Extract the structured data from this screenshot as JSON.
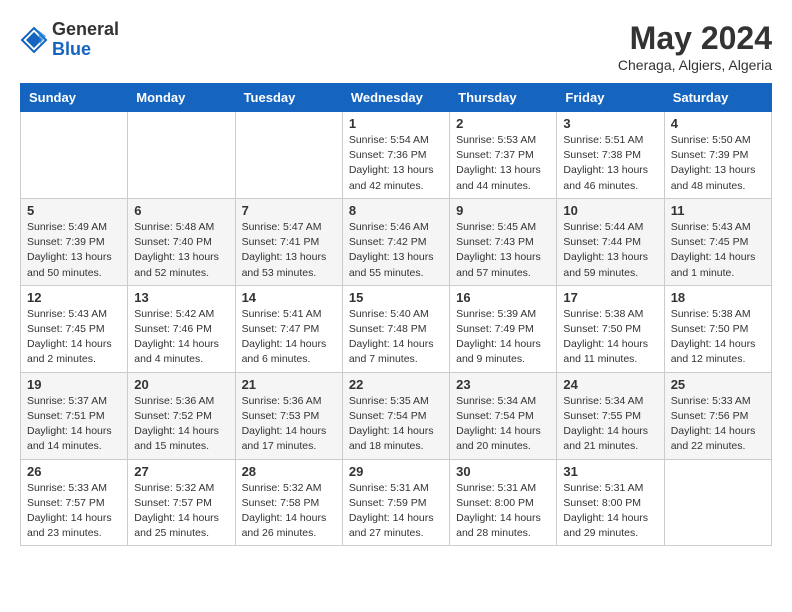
{
  "header": {
    "logo_line1": "General",
    "logo_line2": "Blue",
    "month_title": "May 2024",
    "subtitle": "Cheraga, Algiers, Algeria"
  },
  "weekdays": [
    "Sunday",
    "Monday",
    "Tuesday",
    "Wednesday",
    "Thursday",
    "Friday",
    "Saturday"
  ],
  "weeks": [
    [
      {
        "day": "",
        "info": ""
      },
      {
        "day": "",
        "info": ""
      },
      {
        "day": "",
        "info": ""
      },
      {
        "day": "1",
        "info": "Sunrise: 5:54 AM\nSunset: 7:36 PM\nDaylight: 13 hours\nand 42 minutes."
      },
      {
        "day": "2",
        "info": "Sunrise: 5:53 AM\nSunset: 7:37 PM\nDaylight: 13 hours\nand 44 minutes."
      },
      {
        "day": "3",
        "info": "Sunrise: 5:51 AM\nSunset: 7:38 PM\nDaylight: 13 hours\nand 46 minutes."
      },
      {
        "day": "4",
        "info": "Sunrise: 5:50 AM\nSunset: 7:39 PM\nDaylight: 13 hours\nand 48 minutes."
      }
    ],
    [
      {
        "day": "5",
        "info": "Sunrise: 5:49 AM\nSunset: 7:39 PM\nDaylight: 13 hours\nand 50 minutes."
      },
      {
        "day": "6",
        "info": "Sunrise: 5:48 AM\nSunset: 7:40 PM\nDaylight: 13 hours\nand 52 minutes."
      },
      {
        "day": "7",
        "info": "Sunrise: 5:47 AM\nSunset: 7:41 PM\nDaylight: 13 hours\nand 53 minutes."
      },
      {
        "day": "8",
        "info": "Sunrise: 5:46 AM\nSunset: 7:42 PM\nDaylight: 13 hours\nand 55 minutes."
      },
      {
        "day": "9",
        "info": "Sunrise: 5:45 AM\nSunset: 7:43 PM\nDaylight: 13 hours\nand 57 minutes."
      },
      {
        "day": "10",
        "info": "Sunrise: 5:44 AM\nSunset: 7:44 PM\nDaylight: 13 hours\nand 59 minutes."
      },
      {
        "day": "11",
        "info": "Sunrise: 5:43 AM\nSunset: 7:45 PM\nDaylight: 14 hours\nand 1 minute."
      }
    ],
    [
      {
        "day": "12",
        "info": "Sunrise: 5:43 AM\nSunset: 7:45 PM\nDaylight: 14 hours\nand 2 minutes."
      },
      {
        "day": "13",
        "info": "Sunrise: 5:42 AM\nSunset: 7:46 PM\nDaylight: 14 hours\nand 4 minutes."
      },
      {
        "day": "14",
        "info": "Sunrise: 5:41 AM\nSunset: 7:47 PM\nDaylight: 14 hours\nand 6 minutes."
      },
      {
        "day": "15",
        "info": "Sunrise: 5:40 AM\nSunset: 7:48 PM\nDaylight: 14 hours\nand 7 minutes."
      },
      {
        "day": "16",
        "info": "Sunrise: 5:39 AM\nSunset: 7:49 PM\nDaylight: 14 hours\nand 9 minutes."
      },
      {
        "day": "17",
        "info": "Sunrise: 5:38 AM\nSunset: 7:50 PM\nDaylight: 14 hours\nand 11 minutes."
      },
      {
        "day": "18",
        "info": "Sunrise: 5:38 AM\nSunset: 7:50 PM\nDaylight: 14 hours\nand 12 minutes."
      }
    ],
    [
      {
        "day": "19",
        "info": "Sunrise: 5:37 AM\nSunset: 7:51 PM\nDaylight: 14 hours\nand 14 minutes."
      },
      {
        "day": "20",
        "info": "Sunrise: 5:36 AM\nSunset: 7:52 PM\nDaylight: 14 hours\nand 15 minutes."
      },
      {
        "day": "21",
        "info": "Sunrise: 5:36 AM\nSunset: 7:53 PM\nDaylight: 14 hours\nand 17 minutes."
      },
      {
        "day": "22",
        "info": "Sunrise: 5:35 AM\nSunset: 7:54 PM\nDaylight: 14 hours\nand 18 minutes."
      },
      {
        "day": "23",
        "info": "Sunrise: 5:34 AM\nSunset: 7:54 PM\nDaylight: 14 hours\nand 20 minutes."
      },
      {
        "day": "24",
        "info": "Sunrise: 5:34 AM\nSunset: 7:55 PM\nDaylight: 14 hours\nand 21 minutes."
      },
      {
        "day": "25",
        "info": "Sunrise: 5:33 AM\nSunset: 7:56 PM\nDaylight: 14 hours\nand 22 minutes."
      }
    ],
    [
      {
        "day": "26",
        "info": "Sunrise: 5:33 AM\nSunset: 7:57 PM\nDaylight: 14 hours\nand 23 minutes."
      },
      {
        "day": "27",
        "info": "Sunrise: 5:32 AM\nSunset: 7:57 PM\nDaylight: 14 hours\nand 25 minutes."
      },
      {
        "day": "28",
        "info": "Sunrise: 5:32 AM\nSunset: 7:58 PM\nDaylight: 14 hours\nand 26 minutes."
      },
      {
        "day": "29",
        "info": "Sunrise: 5:31 AM\nSunset: 7:59 PM\nDaylight: 14 hours\nand 27 minutes."
      },
      {
        "day": "30",
        "info": "Sunrise: 5:31 AM\nSunset: 8:00 PM\nDaylight: 14 hours\nand 28 minutes."
      },
      {
        "day": "31",
        "info": "Sunrise: 5:31 AM\nSunset: 8:00 PM\nDaylight: 14 hours\nand 29 minutes."
      },
      {
        "day": "",
        "info": ""
      }
    ]
  ]
}
